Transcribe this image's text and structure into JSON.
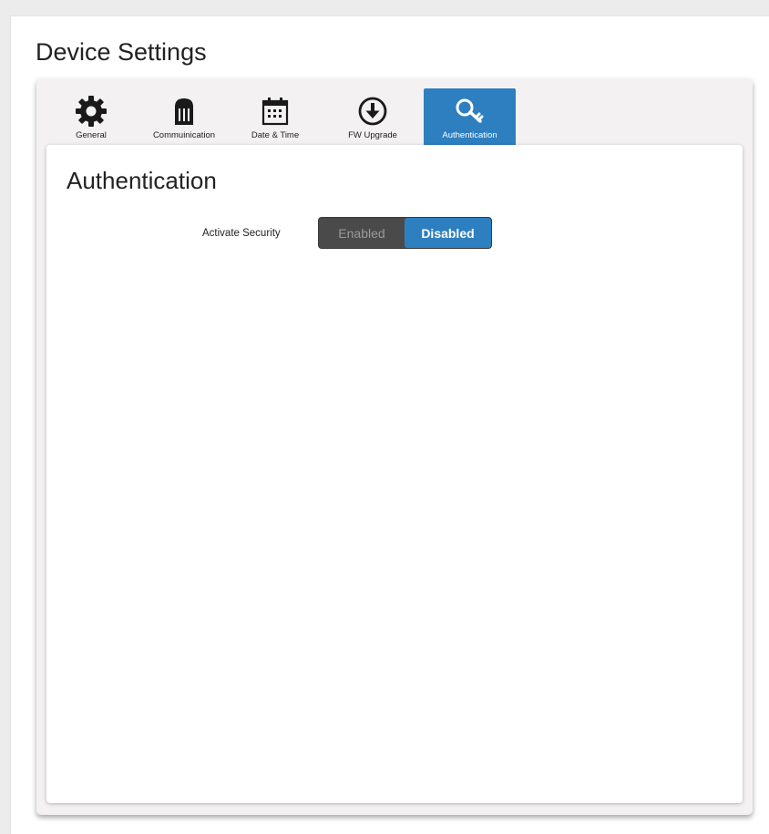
{
  "page": {
    "title": "Device Settings"
  },
  "tabs": [
    {
      "label": "General",
      "icon": "gear-icon",
      "active": false
    },
    {
      "label": "Commuinication",
      "icon": "connector-icon",
      "active": false
    },
    {
      "label": "Date & Time",
      "icon": "calendar-icon",
      "active": false
    },
    {
      "label": "FW Upgrade",
      "icon": "download-icon",
      "active": false
    },
    {
      "label": "Authentication",
      "icon": "key-icon",
      "active": true
    }
  ],
  "section": {
    "title": "Authentication",
    "activate_security": {
      "label": "Activate Security",
      "options": [
        "Enabled",
        "Disabled"
      ],
      "selected": "Disabled"
    }
  },
  "colors": {
    "accent": "#2d7fc0",
    "toggle_off_bg": "#4a4a4a",
    "panel_bg": "#f3f1f1"
  }
}
